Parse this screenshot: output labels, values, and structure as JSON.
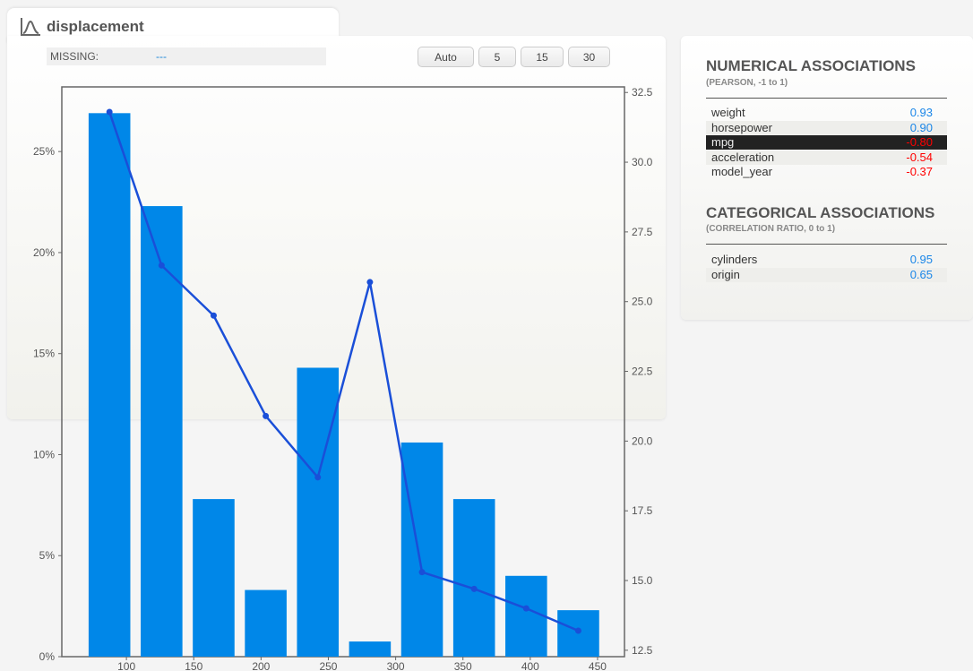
{
  "header": {
    "title": "displacement",
    "icon": "distribution-icon"
  },
  "missing": {
    "label": "MISSING:",
    "value": "---"
  },
  "bin_buttons": [
    "Auto",
    "5",
    "15",
    "30"
  ],
  "numerical": {
    "title": "NUMERICAL ASSOCIATIONS",
    "subtitle": "(PEARSON, -1 to 1)",
    "rows": [
      {
        "name": "weight",
        "value": "0.93",
        "color": "#1a86e8"
      },
      {
        "name": "horsepower",
        "value": "0.90",
        "color": "#1a86e8"
      },
      {
        "name": "mpg",
        "value": "-0.80",
        "color": "#ff0000"
      },
      {
        "name": "acceleration",
        "value": "-0.54",
        "color": "#ff0000"
      },
      {
        "name": "model_year",
        "value": "-0.37",
        "color": "#ff0000"
      }
    ]
  },
  "categorical": {
    "title": "CATEGORICAL ASSOCIATIONS",
    "subtitle": "(CORRELATION RATIO, 0 to 1)",
    "rows": [
      {
        "name": "cylinders",
        "value": "0.95",
        "color": "#1a86e8"
      },
      {
        "name": "origin",
        "value": "0.65",
        "color": "#1a86e8"
      }
    ]
  },
  "chart_data": {
    "type": "bar",
    "title": "",
    "xlabel": "",
    "ylabel": "",
    "x": [
      87.4,
      126.1,
      164.8,
      203.5,
      242.2,
      280.9,
      319.6,
      358.3,
      397.0,
      435.7
    ],
    "bar_width": 31,
    "values": [
      26.9,
      22.3,
      7.8,
      3.3,
      14.3,
      0.75,
      10.6,
      7.8,
      4.0,
      2.3
    ],
    "line": {
      "name": "mpg",
      "values": [
        31.8,
        26.3,
        24.5,
        20.9,
        18.7,
        25.7,
        15.3,
        14.7,
        14.0,
        13.2
      ],
      "color": "#1a4fd8"
    },
    "bar_color": "#0087e8",
    "xlim": [
      52,
      470
    ],
    "ylim": [
      0,
      28.2
    ],
    "y2lim": [
      12.27,
      32.7
    ],
    "xticks": [
      100,
      150,
      200,
      250,
      300,
      350,
      400,
      450
    ],
    "yticks": [
      "0%",
      "5%",
      "10%",
      "15%",
      "20%",
      "25%"
    ],
    "ytick_values": [
      0,
      5,
      10,
      15,
      20,
      25
    ],
    "y2ticks": [
      "12.5",
      "15.0",
      "17.5",
      "20.0",
      "22.5",
      "25.0",
      "27.5",
      "30.0",
      "32.5"
    ],
    "y2tick_values": [
      12.5,
      15,
      17.5,
      20,
      22.5,
      25,
      27.5,
      30,
      32.5
    ],
    "grid": false
  }
}
